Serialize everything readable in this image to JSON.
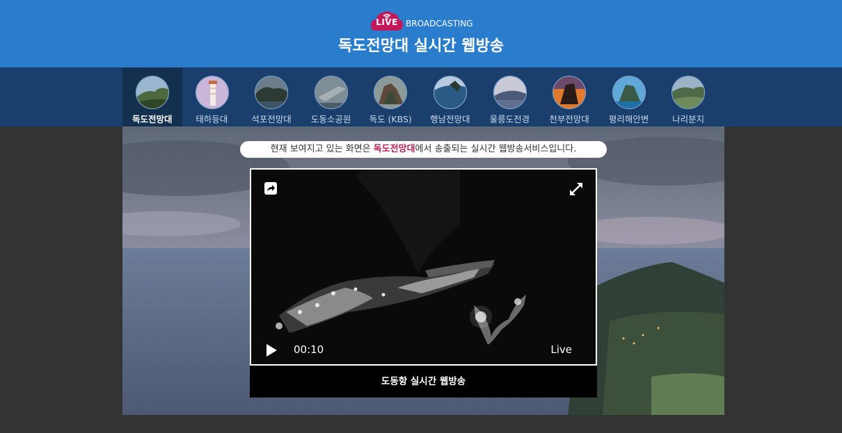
{
  "header": {
    "live_badge": "LIVE",
    "broadcasting": "BROADCASTING",
    "title": "독도전망대 실시간 웹방송"
  },
  "tabs": [
    {
      "label": "독도전망대",
      "active": true
    },
    {
      "label": "태하등대",
      "active": false
    },
    {
      "label": "석포전망대",
      "active": false
    },
    {
      "label": "도동소공원",
      "active": false
    },
    {
      "label": "독도 (KBS)",
      "active": false
    },
    {
      "label": "행남전망대",
      "active": false
    },
    {
      "label": "울릉도전경",
      "active": false
    },
    {
      "label": "천부전망대",
      "active": false
    },
    {
      "label": "평리해안변",
      "active": false
    },
    {
      "label": "나리분지",
      "active": false
    }
  ],
  "notice": {
    "prefix": "현재 보여지고 있는 화면은 ",
    "highlight": "독도전망대",
    "suffix": "에서 송출되는 실시간 웹방송서비스입니다."
  },
  "player": {
    "time": "00:10",
    "live": "Live",
    "caption": "도동항 실시간 웹방송",
    "icons": [
      "share-icon",
      "fullscreen-icon",
      "play-icon"
    ]
  },
  "colors": {
    "header_bg": "#2a7ccc",
    "nav_bg": "#1a3f6d",
    "active_tab_bg": "#14304f",
    "badge": "#c2185b",
    "highlight": "#b81f57",
    "page_bg": "#333333"
  }
}
